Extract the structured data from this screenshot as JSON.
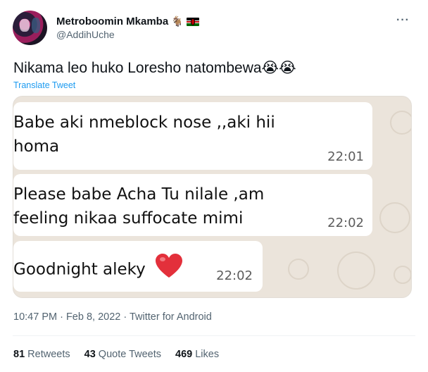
{
  "tweet": {
    "display_name": "Metroboomin Mkamba",
    "handle": "@AddihUche",
    "name_emoji": "🐐",
    "text": "Nikama leo huko Loresho natombewa😭😭",
    "translate_label": "Translate Tweet",
    "timestamp": "10:47 PM · Feb 8, 2022 · Twitter for Android",
    "more_icon": "more-horizontal-icon"
  },
  "media": {
    "messages": [
      {
        "lines": [
          "Babe aki nmeblock nose ,,aki hii",
          "homa"
        ],
        "time": "22:01"
      },
      {
        "lines": [
          "Please babe Acha Tu nilale ,am",
          "feeling nikaa suffocate mimi"
        ],
        "time": "22:02"
      },
      {
        "lines": [
          "Goodnight aleky"
        ],
        "time": "22:02",
        "emoji": "heart-icon"
      }
    ]
  },
  "stats": {
    "retweets_count": "81",
    "retweets_label": "Retweets",
    "quotes_count": "43",
    "quotes_label": "Quote Tweets",
    "likes_count": "469",
    "likes_label": "Likes"
  },
  "colors": {
    "accent": "#1d9bf0",
    "secondary_text": "#536471",
    "chat_background": "#ebe4db"
  }
}
